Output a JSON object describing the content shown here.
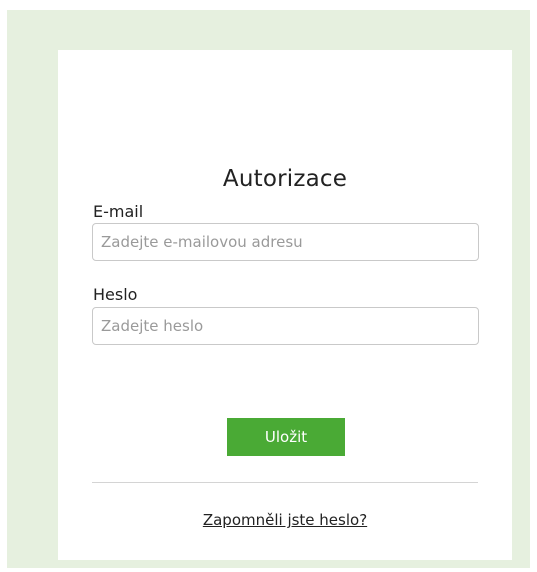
{
  "form": {
    "title": "Autorizace",
    "email": {
      "label": "E-mail",
      "placeholder": "Zadejte e-mailovou adresu",
      "value": ""
    },
    "password": {
      "label": "Heslo",
      "placeholder": "Zadejte heslo",
      "value": ""
    },
    "save_label": "Uložit",
    "forgot_label": "Zapomněli jste heslo?"
  },
  "colors": {
    "background_frame": "#e6f0df",
    "card": "#ffffff",
    "accent": "#4aaa35",
    "border": "#c9c9c9"
  }
}
